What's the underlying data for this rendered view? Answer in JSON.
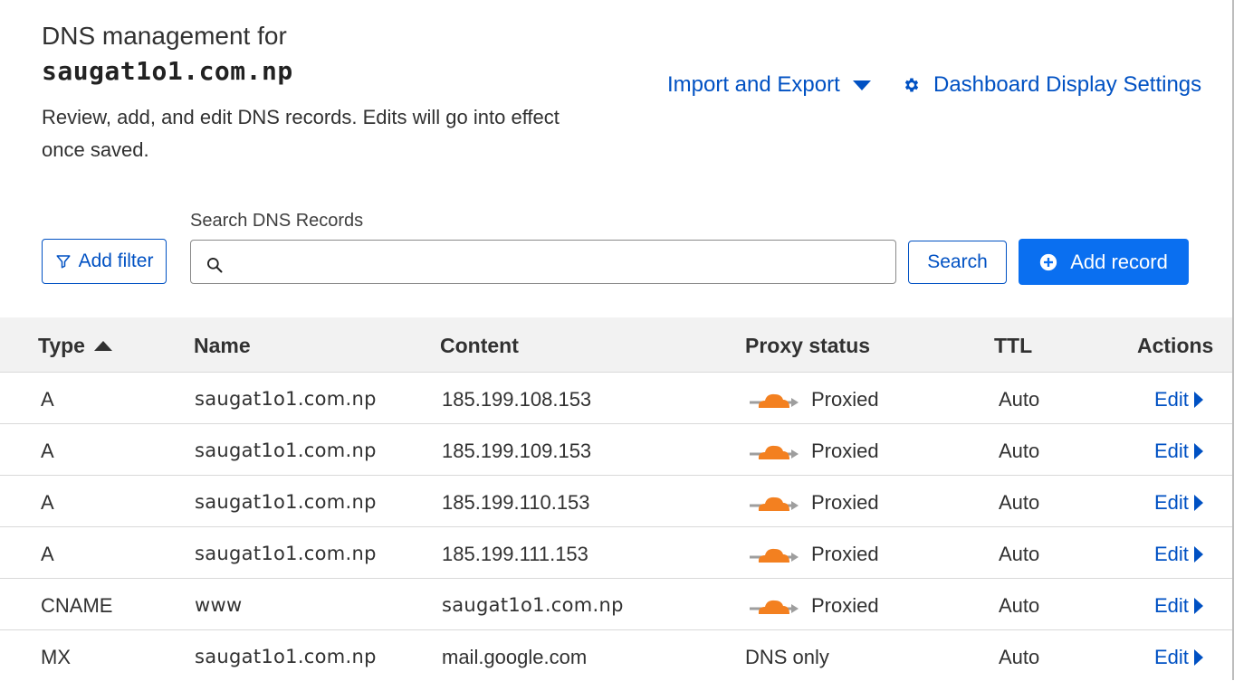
{
  "header": {
    "title_prefix": "DNS management for",
    "domain": "saugat1o1.com.np",
    "description": "Review, add, and edit DNS records. Edits will go into effect once saved.",
    "import_export_label": "Import and Export",
    "display_settings_label": "Dashboard Display Settings"
  },
  "toolbar": {
    "search_label": "Search DNS Records",
    "search_value": "",
    "search_placeholder": "",
    "add_filter_label": "Add filter",
    "search_button_label": "Search",
    "add_record_label": "Add record"
  },
  "table": {
    "headers": {
      "type": "Type",
      "name": "Name",
      "content": "Content",
      "proxy_status": "Proxy status",
      "ttl": "TTL",
      "actions": "Actions"
    },
    "sort": {
      "column": "Type",
      "direction": "ascending"
    },
    "rows": [
      {
        "type": "A",
        "name": "saugat1o1.com.np",
        "content": "185.199.108.153",
        "proxy_status": "Proxied",
        "proxied": true,
        "ttl": "Auto",
        "action": "Edit"
      },
      {
        "type": "A",
        "name": "saugat1o1.com.np",
        "content": "185.199.109.153",
        "proxy_status": "Proxied",
        "proxied": true,
        "ttl": "Auto",
        "action": "Edit"
      },
      {
        "type": "A",
        "name": "saugat1o1.com.np",
        "content": "185.199.110.153",
        "proxy_status": "Proxied",
        "proxied": true,
        "ttl": "Auto",
        "action": "Edit"
      },
      {
        "type": "A",
        "name": "saugat1o1.com.np",
        "content": "185.199.111.153",
        "proxy_status": "Proxied",
        "proxied": true,
        "ttl": "Auto",
        "action": "Edit"
      },
      {
        "type": "CNAME",
        "name": "www",
        "content": "saugat1o1.com.np",
        "proxy_status": "Proxied",
        "proxied": true,
        "ttl": "Auto",
        "action": "Edit"
      },
      {
        "type": "MX",
        "name": "saugat1o1.com.np",
        "content": "mail.google.com",
        "proxy_status": "DNS only",
        "proxied": false,
        "ttl": "Auto",
        "action": "Edit"
      }
    ]
  },
  "colors": {
    "link_blue": "#0051c3",
    "primary_button": "#0a6ff0",
    "proxy_cloud_orange": "#f38020",
    "header_row_bg": "#f2f2f2"
  },
  "icons": {
    "filter": "filter-icon",
    "search": "search-icon",
    "settings": "gear-icon",
    "add": "plus-circle-icon",
    "dropdown": "caret-down-icon",
    "sort": "sort-ascending-icon",
    "proxied": "orange-cloud-icon",
    "edit": "chevron-right-icon"
  }
}
